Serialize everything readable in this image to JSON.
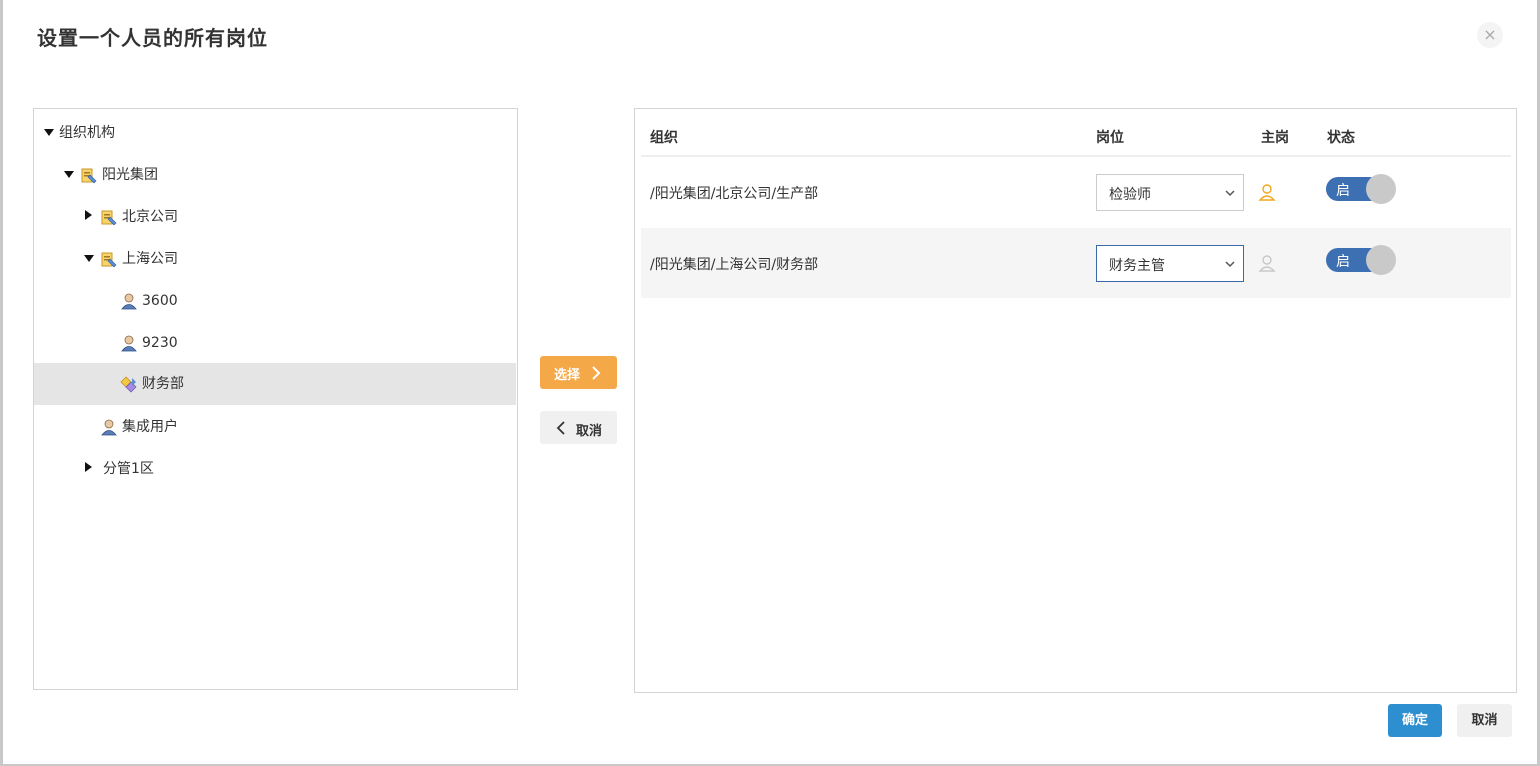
{
  "dialog": {
    "title": "设置一个人员的所有岗位",
    "close_glyph": "×"
  },
  "tree": {
    "root": "组织机构",
    "group": "阳光集团",
    "beijing": "北京公司",
    "shanghai": "上海公司",
    "user_3600": "3600",
    "user_9230": "9230",
    "finance_dept": "财务部",
    "integration_user": "集成用户",
    "branch_1": "分管1区"
  },
  "transfer": {
    "select_label": "选择",
    "unselect_label": "取消"
  },
  "grid": {
    "columns": [
      "组织",
      "岗位",
      "主岗",
      "状态"
    ],
    "rows": [
      {
        "org": "/阳光集团/北京公司/生产部",
        "post": "检验师",
        "is_main": true,
        "status": "启"
      },
      {
        "org": "/阳光集团/上海公司/财务部",
        "post": "财务主管",
        "is_main": false,
        "status": "启"
      }
    ]
  },
  "footer": {
    "ok_label": "确定",
    "cancel_label": "取消"
  },
  "colors": {
    "select_button": "#f5a847",
    "ok_button": "#2e8fd0",
    "toggle_on": "#3c70b3",
    "main_post_active": "#f0a818"
  }
}
